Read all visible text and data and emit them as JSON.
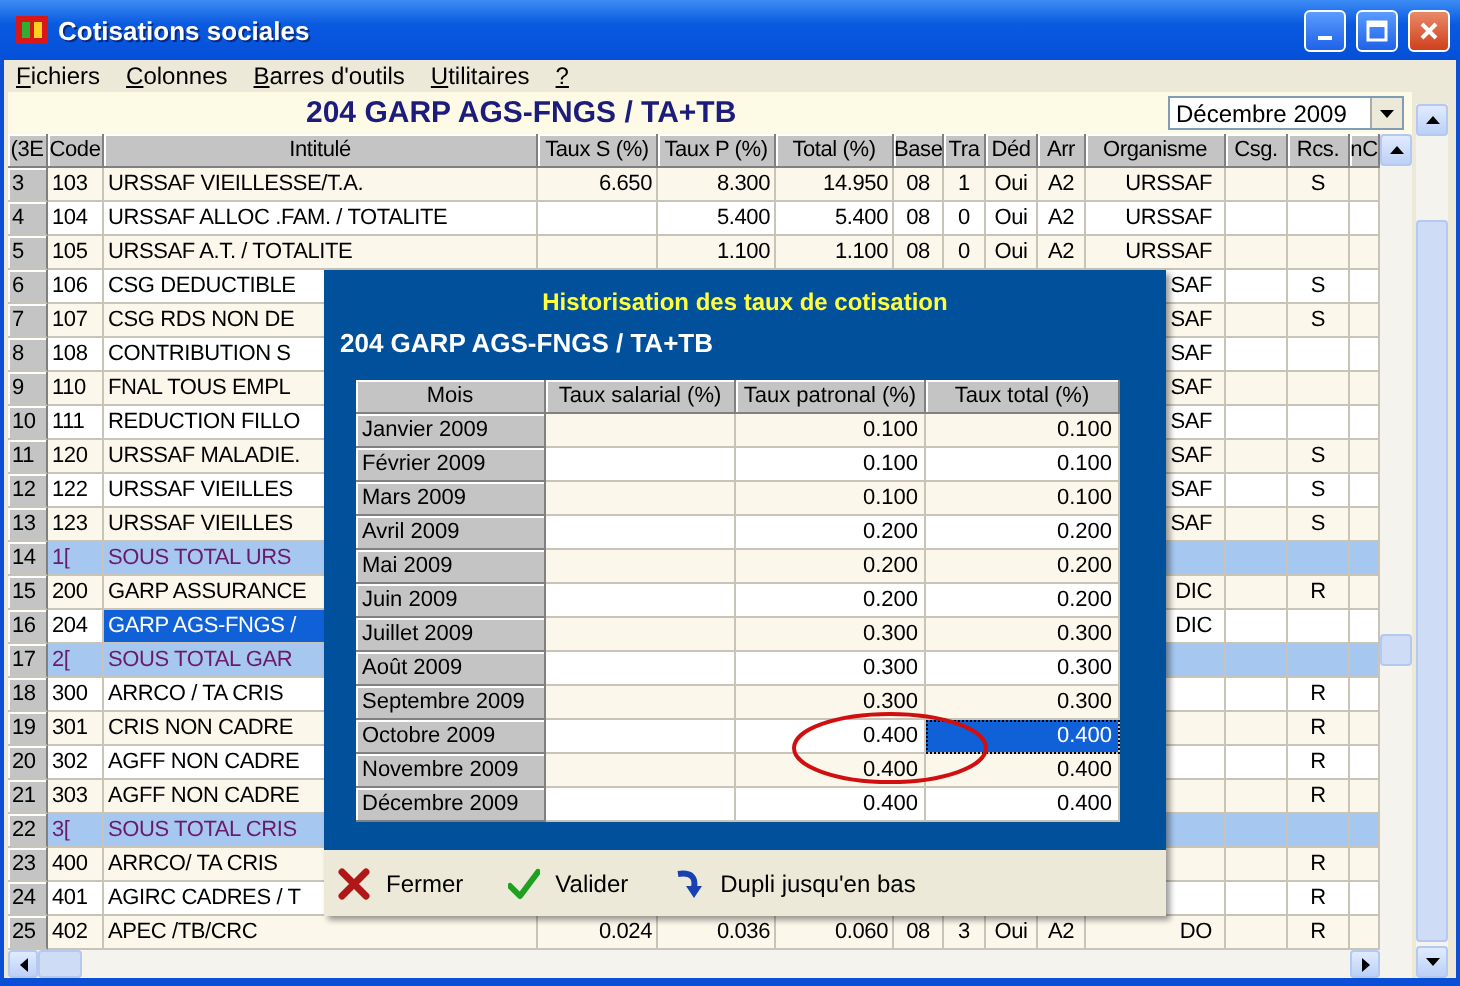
{
  "window": {
    "title": "Cotisations sociales"
  },
  "menu": [
    "Fichiers",
    "Colonnes",
    "Barres d'outils",
    "Utilitaires",
    "?"
  ],
  "header": {
    "title": "204 GARP AGS-FNGS / TA+TB",
    "period": "Décembre 2009"
  },
  "grid": {
    "columns": [
      "(3E",
      "Code",
      "Intitulé",
      "Taux S (%)",
      "Taux P (%)",
      "Total (%)",
      "Base",
      "Tra",
      "Déd",
      "Arr",
      "Organisme",
      "Csg.",
      "Rcs.",
      "nC"
    ],
    "rows": [
      {
        "kind": "line",
        "selected": false,
        "cells": [
          "3",
          "103",
          "URSSAF VIEILLESSE/T.A.",
          "6.650",
          "8.300",
          "14.950",
          "08",
          "1",
          "Oui",
          "A2",
          "URSSAF",
          null,
          "S",
          null
        ]
      },
      {
        "kind": "line",
        "selected": false,
        "cells": [
          "4",
          "104",
          "URSSAF ALLOC .FAM. / TOTALITE",
          null,
          "5.400",
          "5.400",
          "08",
          "0",
          "Oui",
          "A2",
          "URSSAF",
          null,
          null,
          null
        ]
      },
      {
        "kind": "line",
        "selected": false,
        "cells": [
          "5",
          "105",
          "URSSAF A.T. / TOTALITE",
          null,
          "1.100",
          "1.100",
          "08",
          "0",
          "Oui",
          "A2",
          "URSSAF",
          null,
          null,
          null
        ]
      },
      {
        "kind": "line",
        "selected": false,
        "cells": [
          "6",
          "106",
          "CSG DEDUCTIBLE",
          null,
          null,
          null,
          null,
          null,
          null,
          null,
          "SAF",
          null,
          "S",
          null
        ]
      },
      {
        "kind": "line",
        "selected": false,
        "cells": [
          "7",
          "107",
          "CSG RDS NON DE",
          null,
          null,
          null,
          null,
          null,
          null,
          null,
          "SAF",
          null,
          "S",
          null
        ]
      },
      {
        "kind": "line",
        "selected": false,
        "cells": [
          "8",
          "108",
          "CONTRIBUTION S",
          null,
          null,
          null,
          null,
          null,
          null,
          null,
          "SAF",
          null,
          null,
          null
        ]
      },
      {
        "kind": "line",
        "selected": false,
        "cells": [
          "9",
          "110",
          "FNAL TOUS EMPL",
          null,
          null,
          null,
          null,
          null,
          null,
          null,
          "SAF",
          null,
          null,
          null
        ]
      },
      {
        "kind": "line",
        "selected": false,
        "cells": [
          "10",
          "111",
          "REDUCTION FILLO",
          null,
          null,
          null,
          null,
          null,
          null,
          null,
          "SAF",
          null,
          null,
          null
        ]
      },
      {
        "kind": "line",
        "selected": false,
        "cells": [
          "11",
          "120",
          "URSSAF MALADIE.",
          null,
          null,
          null,
          null,
          null,
          null,
          null,
          "SAF",
          null,
          "S",
          null
        ]
      },
      {
        "kind": "line",
        "selected": false,
        "cells": [
          "12",
          "122",
          "URSSAF VIEILLES",
          null,
          null,
          null,
          null,
          null,
          null,
          null,
          "SAF",
          null,
          "S",
          null
        ]
      },
      {
        "kind": "line",
        "selected": false,
        "cells": [
          "13",
          "123",
          "URSSAF VIEILLES",
          null,
          null,
          null,
          null,
          null,
          null,
          null,
          "SAF",
          null,
          "S",
          null
        ]
      },
      {
        "kind": "subtotal",
        "selected": false,
        "cells": [
          "14",
          "1[",
          "SOUS TOTAL URS",
          null,
          null,
          null,
          null,
          null,
          null,
          null,
          null,
          null,
          null,
          null
        ]
      },
      {
        "kind": "line",
        "selected": false,
        "cells": [
          "15",
          "200",
          "GARP ASSURANCE",
          null,
          null,
          null,
          null,
          null,
          null,
          null,
          "DIC",
          null,
          "R",
          null
        ]
      },
      {
        "kind": "line",
        "selected": true,
        "cells": [
          "16",
          "204",
          "GARP AGS-FNGS /",
          null,
          null,
          null,
          null,
          null,
          null,
          null,
          "DIC",
          null,
          null,
          null
        ]
      },
      {
        "kind": "subtotal",
        "selected": false,
        "cells": [
          "17",
          "2[",
          "SOUS TOTAL GAR",
          null,
          null,
          null,
          null,
          null,
          null,
          null,
          null,
          null,
          null,
          null
        ]
      },
      {
        "kind": "line",
        "selected": false,
        "cells": [
          "18",
          "300",
          "ARRCO / TA CRIS",
          null,
          null,
          null,
          null,
          null,
          null,
          null,
          null,
          null,
          "R",
          null
        ]
      },
      {
        "kind": "line",
        "selected": false,
        "cells": [
          "19",
          "301",
          "CRIS NON CADRE",
          null,
          null,
          null,
          null,
          null,
          null,
          null,
          null,
          null,
          "R",
          null
        ]
      },
      {
        "kind": "line",
        "selected": false,
        "cells": [
          "20",
          "302",
          "AGFF NON CADRE",
          null,
          null,
          null,
          null,
          null,
          null,
          null,
          null,
          null,
          "R",
          null
        ]
      },
      {
        "kind": "line",
        "selected": false,
        "cells": [
          "21",
          "303",
          "AGFF NON CADRE",
          null,
          null,
          null,
          null,
          null,
          null,
          null,
          null,
          null,
          "R",
          null
        ]
      },
      {
        "kind": "subtotal",
        "selected": false,
        "cells": [
          "22",
          "3[",
          "SOUS TOTAL CRIS",
          null,
          null,
          null,
          null,
          null,
          null,
          null,
          null,
          null,
          null,
          null
        ]
      },
      {
        "kind": "line",
        "selected": false,
        "cells": [
          "23",
          "400",
          "ARRCO/ TA  CRIS",
          null,
          null,
          null,
          null,
          null,
          null,
          null,
          null,
          null,
          "R",
          null
        ]
      },
      {
        "kind": "line",
        "selected": false,
        "cells": [
          "24",
          "401",
          "AGIRC CADRES / T",
          null,
          null,
          null,
          null,
          null,
          null,
          null,
          null,
          null,
          "R",
          null
        ]
      },
      {
        "kind": "line",
        "selected": false,
        "cells": [
          "25",
          "402",
          "APEC /TB/CRC",
          "0.024",
          "0.036",
          "0.060",
          "08",
          "3",
          "Oui",
          "A2",
          "DO",
          null,
          "R",
          null
        ]
      }
    ]
  },
  "dialog": {
    "title": "Historisation des taux de cotisation",
    "subtitle": "204 GARP AGS-FNGS / TA+TB",
    "columns": [
      "Mois",
      "Taux salarial (%)",
      "Taux patronal (%)",
      "Taux total (%)"
    ],
    "rows": [
      {
        "month": "Janvier 2009",
        "patronal": "0.100",
        "total": "0.100",
        "selected": false
      },
      {
        "month": "Février 2009",
        "patronal": "0.100",
        "total": "0.100",
        "selected": false
      },
      {
        "month": "Mars 2009",
        "patronal": "0.100",
        "total": "0.100",
        "selected": false
      },
      {
        "month": "Avril 2009",
        "patronal": "0.200",
        "total": "0.200",
        "selected": false
      },
      {
        "month": "Mai 2009",
        "patronal": "0.200",
        "total": "0.200",
        "selected": false
      },
      {
        "month": "Juin 2009",
        "patronal": "0.200",
        "total": "0.200",
        "selected": false
      },
      {
        "month": "Juillet 2009",
        "patronal": "0.300",
        "total": "0.300",
        "selected": false
      },
      {
        "month": "Août 2009",
        "patronal": "0.300",
        "total": "0.300",
        "selected": false
      },
      {
        "month": "Septembre 2009",
        "patronal": "0.300",
        "total": "0.300",
        "selected": false
      },
      {
        "month": "Octobre 2009",
        "patronal": "0.400",
        "total": "0.400",
        "selected": true
      },
      {
        "month": "Novembre 2009",
        "patronal": "0.400",
        "total": "0.400",
        "selected": false
      },
      {
        "month": "Décembre 2009",
        "patronal": "0.400",
        "total": "0.400",
        "selected": false
      }
    ],
    "buttons": [
      {
        "kind": "close",
        "label": "Fermer"
      },
      {
        "kind": "validate",
        "label": "Valider"
      },
      {
        "kind": "duplicate",
        "label": "Dupli jusqu'en bas"
      }
    ]
  }
}
